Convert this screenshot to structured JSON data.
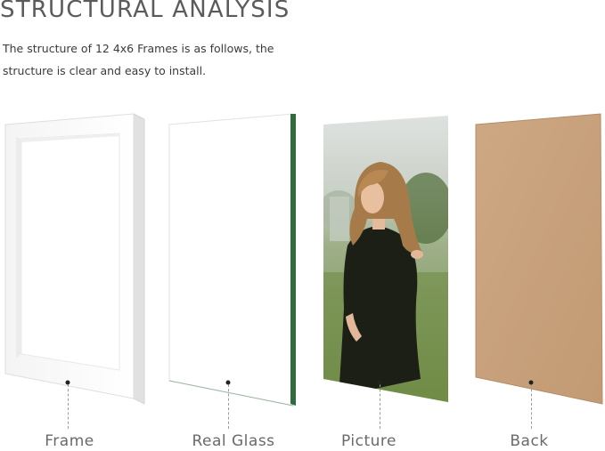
{
  "header": {
    "title": "STRUCTURAL ANALYSIS",
    "description_line1": "The structure of 12 4x6 Frames is as follows, the",
    "description_line2": "structure is clear and easy to install."
  },
  "components": [
    {
      "label": "Frame",
      "icon": "frame-panel"
    },
    {
      "label": "Real Glass",
      "icon": "glass-panel"
    },
    {
      "label": "Picture",
      "icon": "photo-panel"
    },
    {
      "label": "Back",
      "icon": "backboard-panel"
    }
  ],
  "colors": {
    "title": "#5b5b5b",
    "frame": "#ffffff",
    "glass_edge": "#2f6b3c",
    "backboard": "#c9a27e"
  }
}
